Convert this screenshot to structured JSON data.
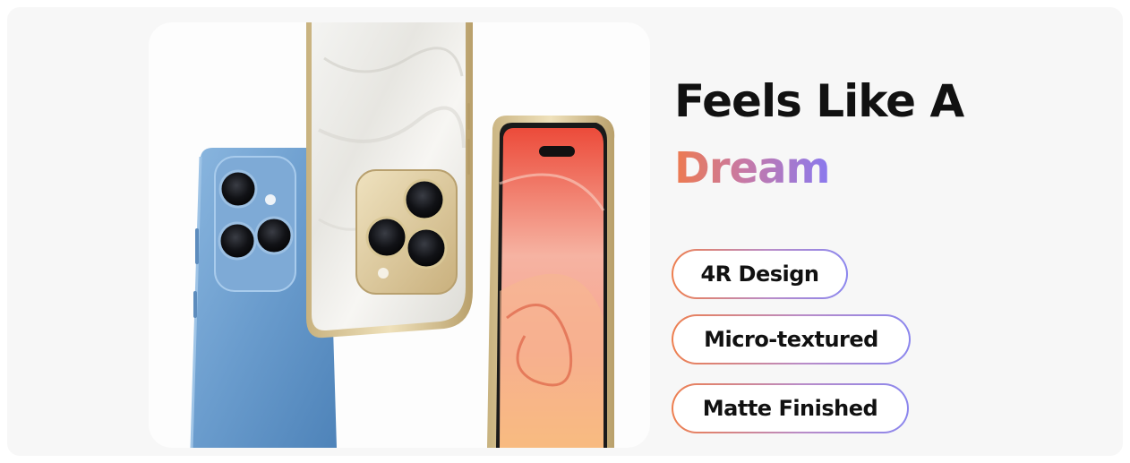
{
  "banner": {
    "headline": "Feels Like A",
    "headline_accent": "Dream",
    "features": [
      "4R Design",
      "Micro-textured",
      "Matte Finished"
    ]
  },
  "colors": {
    "accent_start": "#ee7a4e",
    "accent_end": "#8a79ee",
    "phone_blue": "#6f9fcf",
    "phone_gold": "#d9c59a"
  }
}
